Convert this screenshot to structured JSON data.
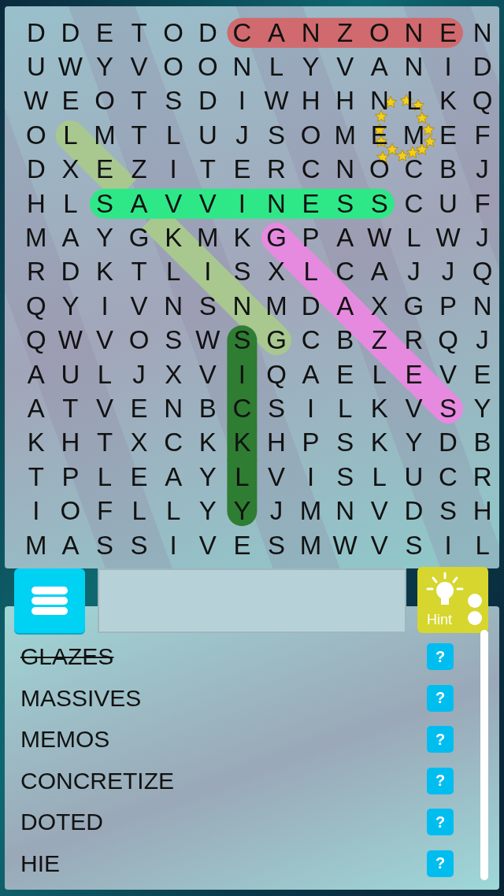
{
  "grid": {
    "rows": [
      [
        {
          "letter": "D"
        },
        {
          "letter": "D"
        },
        {
          "letter": "E"
        },
        {
          "letter": "T"
        },
        {
          "letter": "O"
        },
        {
          "letter": "D"
        },
        {
          "letter": "C",
          "color": "#d06a6e"
        },
        {
          "letter": "A",
          "color": "#d06a6e"
        },
        {
          "letter": "N",
          "color": "#d06a6e"
        },
        {
          "letter": "Z",
          "color": "#d06a6e"
        },
        {
          "letter": "O",
          "color": "#d06a6e"
        },
        {
          "letter": "N",
          "color": "#d06a6e"
        },
        {
          "letter": "E",
          "color": "#d06a6e"
        },
        {
          "letter": "N"
        }
      ],
      [
        {
          "letter": "U"
        },
        {
          "letter": "W"
        },
        {
          "letter": "Y"
        },
        {
          "letter": "V"
        },
        {
          "letter": "O"
        },
        {
          "letter": "O"
        },
        {
          "letter": "N"
        },
        {
          "letter": "L"
        },
        {
          "letter": "Y"
        },
        {
          "letter": "V"
        },
        {
          "letter": "A"
        },
        {
          "letter": "N"
        },
        {
          "letter": "I"
        },
        {
          "letter": "D"
        }
      ],
      [
        {
          "letter": "W"
        },
        {
          "letter": "E"
        },
        {
          "letter": "O"
        },
        {
          "letter": "T"
        },
        {
          "letter": "S"
        },
        {
          "letter": "D"
        },
        {
          "letter": "I"
        },
        {
          "letter": "W"
        },
        {
          "letter": "H"
        },
        {
          "letter": "H"
        },
        {
          "letter": "N"
        },
        {
          "letter": "L"
        },
        {
          "letter": "K"
        },
        {
          "letter": "Q"
        }
      ],
      [
        {
          "letter": "O"
        },
        {
          "letter": "L",
          "color": "#a8c890"
        },
        {
          "letter": "M"
        },
        {
          "letter": "T"
        },
        {
          "letter": "L"
        },
        {
          "letter": "U"
        },
        {
          "letter": "J"
        },
        {
          "letter": "S"
        },
        {
          "letter": "O"
        },
        {
          "letter": "M"
        },
        {
          "letter": "E"
        },
        {
          "letter": "M"
        },
        {
          "letter": "E"
        },
        {
          "letter": "F"
        }
      ],
      [
        {
          "letter": "D"
        },
        {
          "letter": "X"
        },
        {
          "letter": "E",
          "color": "#a8c890"
        },
        {
          "letter": "Z"
        },
        {
          "letter": "I"
        },
        {
          "letter": "T"
        },
        {
          "letter": "E"
        },
        {
          "letter": "R"
        },
        {
          "letter": "C"
        },
        {
          "letter": "N"
        },
        {
          "letter": "O"
        },
        {
          "letter": "C"
        },
        {
          "letter": "B"
        },
        {
          "letter": "J"
        }
      ],
      [
        {
          "letter": "H"
        },
        {
          "letter": "L"
        },
        {
          "letter": "S",
          "color": "#2ee888"
        },
        {
          "letter": "A",
          "color": "#2ee888"
        },
        {
          "letter": "V",
          "color": "#2ee888"
        },
        {
          "letter": "V",
          "color": "#2ee888"
        },
        {
          "letter": "I",
          "color": "#2ee888"
        },
        {
          "letter": "N",
          "color": "#2ee888"
        },
        {
          "letter": "E",
          "color": "#2ee888"
        },
        {
          "letter": "S",
          "color": "#2ee888"
        },
        {
          "letter": "S",
          "color": "#2ee888"
        },
        {
          "letter": "C"
        },
        {
          "letter": "U"
        },
        {
          "letter": "F"
        }
      ],
      [
        {
          "letter": "M"
        },
        {
          "letter": "A"
        },
        {
          "letter": "Y"
        },
        {
          "letter": "G"
        },
        {
          "letter": "K",
          "color": "#a8c890"
        },
        {
          "letter": "M"
        },
        {
          "letter": "K"
        },
        {
          "letter": "G",
          "color": "#e68ae0"
        },
        {
          "letter": "P"
        },
        {
          "letter": "A"
        },
        {
          "letter": "W"
        },
        {
          "letter": "L"
        },
        {
          "letter": "W"
        },
        {
          "letter": "J"
        }
      ],
      [
        {
          "letter": "R"
        },
        {
          "letter": "D"
        },
        {
          "letter": "K"
        },
        {
          "letter": "T"
        },
        {
          "letter": "L"
        },
        {
          "letter": "I",
          "color": "#a8c890"
        },
        {
          "letter": "S"
        },
        {
          "letter": "X"
        },
        {
          "letter": "L",
          "color": "#e68ae0"
        },
        {
          "letter": "C"
        },
        {
          "letter": "A"
        },
        {
          "letter": "J"
        },
        {
          "letter": "J"
        },
        {
          "letter": "Q"
        }
      ],
      [
        {
          "letter": "Q"
        },
        {
          "letter": "Y"
        },
        {
          "letter": "I"
        },
        {
          "letter": "V"
        },
        {
          "letter": "N"
        },
        {
          "letter": "S"
        },
        {
          "letter": "N",
          "color": "#a8c890"
        },
        {
          "letter": "M"
        },
        {
          "letter": "D"
        },
        {
          "letter": "A",
          "color": "#e68ae0"
        },
        {
          "letter": "X"
        },
        {
          "letter": "G"
        },
        {
          "letter": "P"
        },
        {
          "letter": "N"
        }
      ],
      [
        {
          "letter": "Q"
        },
        {
          "letter": "W"
        },
        {
          "letter": "V"
        },
        {
          "letter": "O"
        },
        {
          "letter": "S"
        },
        {
          "letter": "W"
        },
        {
          "letter": "S",
          "color": "#2e7d32"
        },
        {
          "letter": "G",
          "color": "#a8c890"
        },
        {
          "letter": "C"
        },
        {
          "letter": "B"
        },
        {
          "letter": "Z",
          "color": "#e68ae0"
        },
        {
          "letter": "R"
        },
        {
          "letter": "Q"
        },
        {
          "letter": "J"
        }
      ],
      [
        {
          "letter": "A"
        },
        {
          "letter": "U"
        },
        {
          "letter": "L"
        },
        {
          "letter": "J"
        },
        {
          "letter": "X"
        },
        {
          "letter": "V"
        },
        {
          "letter": "I",
          "color": "#2e7d32"
        },
        {
          "letter": "Q"
        },
        {
          "letter": "A"
        },
        {
          "letter": "E"
        },
        {
          "letter": "L"
        },
        {
          "letter": "E",
          "color": "#e68ae0"
        },
        {
          "letter": "V"
        },
        {
          "letter": "E"
        }
      ],
      [
        {
          "letter": "A"
        },
        {
          "letter": "T"
        },
        {
          "letter": "V"
        },
        {
          "letter": "E"
        },
        {
          "letter": "N"
        },
        {
          "letter": "B"
        },
        {
          "letter": "C",
          "color": "#2e7d32"
        },
        {
          "letter": "S"
        },
        {
          "letter": "I"
        },
        {
          "letter": "L"
        },
        {
          "letter": "K"
        },
        {
          "letter": "V"
        },
        {
          "letter": "S",
          "color": "#e68ae0"
        },
        {
          "letter": "Y"
        }
      ],
      [
        {
          "letter": "K"
        },
        {
          "letter": "H"
        },
        {
          "letter": "T"
        },
        {
          "letter": "X"
        },
        {
          "letter": "C"
        },
        {
          "letter": "K"
        },
        {
          "letter": "K",
          "color": "#2e7d32"
        },
        {
          "letter": "H"
        },
        {
          "letter": "P"
        },
        {
          "letter": "S"
        },
        {
          "letter": "K"
        },
        {
          "letter": "Y"
        },
        {
          "letter": "D"
        },
        {
          "letter": "B"
        }
      ],
      [
        {
          "letter": "T"
        },
        {
          "letter": "P"
        },
        {
          "letter": "L"
        },
        {
          "letter": "E"
        },
        {
          "letter": "A"
        },
        {
          "letter": "Y"
        },
        {
          "letter": "L",
          "color": "#2e7d32"
        },
        {
          "letter": "V"
        },
        {
          "letter": "I"
        },
        {
          "letter": "S"
        },
        {
          "letter": "L"
        },
        {
          "letter": "U"
        },
        {
          "letter": "C"
        },
        {
          "letter": "R"
        }
      ],
      [
        {
          "letter": "I"
        },
        {
          "letter": "O"
        },
        {
          "letter": "F"
        },
        {
          "letter": "L"
        },
        {
          "letter": "L"
        },
        {
          "letter": "Y"
        },
        {
          "letter": "Y",
          "color": "#2e7d32"
        },
        {
          "letter": "J"
        },
        {
          "letter": "M"
        },
        {
          "letter": "N"
        },
        {
          "letter": "V"
        },
        {
          "letter": "D"
        },
        {
          "letter": "S"
        },
        {
          "letter": "H"
        }
      ],
      [
        {
          "letter": "M"
        },
        {
          "letter": "A"
        },
        {
          "letter": "S"
        },
        {
          "letter": "S"
        },
        {
          "letter": "I"
        },
        {
          "letter": "V"
        },
        {
          "letter": "E"
        },
        {
          "letter": "S"
        },
        {
          "letter": "M"
        },
        {
          "letter": "W"
        },
        {
          "letter": "V"
        },
        {
          "letter": "S"
        },
        {
          "letter": "I"
        },
        {
          "letter": "L"
        }
      ]
    ]
  },
  "hint_button": {
    "label": "Hint"
  },
  "words": [
    {
      "text": "GLAZES",
      "found": true
    },
    {
      "text": "MASSIVES",
      "found": false
    },
    {
      "text": "MEMOS",
      "found": false
    },
    {
      "text": "CONCRETIZE",
      "found": false
    },
    {
      "text": "DOTED",
      "found": false
    },
    {
      "text": "HIE",
      "found": false
    }
  ],
  "help_label": "?"
}
